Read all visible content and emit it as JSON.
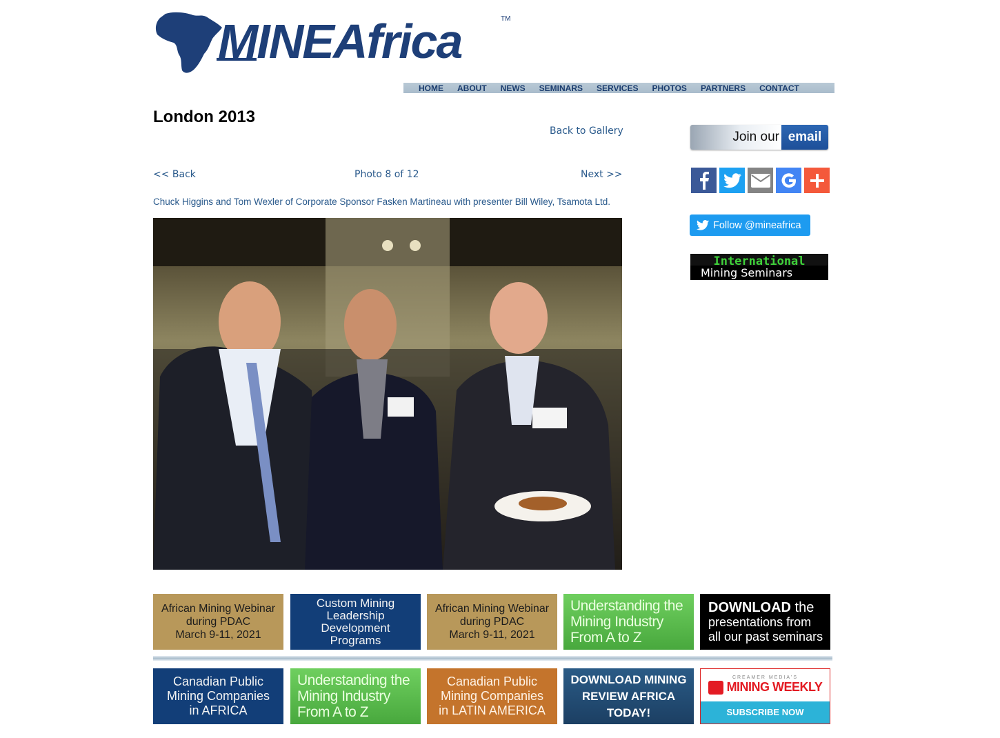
{
  "brand": {
    "logo_text": "MINEAfrica",
    "trademark": "TM",
    "primary_color": "#1e3f78"
  },
  "nav": {
    "items": [
      "HOME",
      "ABOUT",
      "NEWS",
      "SEMINARS",
      "SERVICES",
      "PHOTOS",
      "PARTNERS",
      "CONTACT"
    ]
  },
  "page": {
    "title": "London 2013",
    "back_to_gallery": "Back to Gallery",
    "prev": "<< Back",
    "counter": "Photo 8 of 12",
    "next": "Next >>",
    "caption": "Chuck Higgins and Tom Wexler of Corporate Sponsor Fasken Martineau with presenter Bill Wiley, Tsamota Ltd."
  },
  "sidebar": {
    "join_email": {
      "part1": "Join our",
      "part2": "email"
    },
    "share_icons": [
      "facebook-icon",
      "twitter-icon",
      "email-icon",
      "google-icon",
      "plus-icon"
    ],
    "share_colors": [
      "#3b5998",
      "#1da1f2",
      "#848484",
      "#4285f4",
      "#f4593b"
    ],
    "follow": "Follow @mineafrica",
    "ims": {
      "line1": "International",
      "line2": "Mining Seminars"
    }
  },
  "banners": {
    "row1": [
      {
        "lines": [
          "African Mining Webinar",
          "during PDAC",
          "March 9-11, 2021"
        ]
      },
      {
        "lines": [
          "Custom Mining",
          "Leadership",
          "Development",
          "Programs"
        ]
      },
      {
        "lines": [
          "African Mining Webinar",
          "during PDAC",
          "March 9-11, 2021"
        ]
      },
      {
        "lines": [
          "Understanding the",
          "Mining Industry",
          "From A to Z"
        ]
      },
      {
        "bold": "DOWNLOAD",
        "rest": "the",
        "lines": [
          "presentations from",
          "all our past seminars"
        ]
      }
    ],
    "row2": [
      {
        "lines": [
          "Canadian Public",
          "Mining Companies",
          "in AFRICA"
        ]
      },
      {
        "lines": [
          "Understanding the",
          "Mining Industry",
          "From A to Z"
        ]
      },
      {
        "lines": [
          "Canadian Public",
          "Mining Companies",
          "in LATIN AMERICA"
        ]
      },
      {
        "lines": [
          "DOWNLOAD MINING",
          "REVIEW AFRICA",
          "TODAY!"
        ]
      },
      {
        "top": "CREAMER MEDIA'S",
        "title": "MINING WEEKLY",
        "cta": "SUBSCRIBE NOW"
      }
    ]
  }
}
